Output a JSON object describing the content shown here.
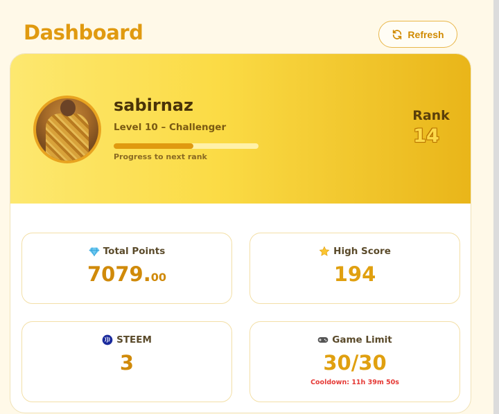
{
  "header": {
    "title": "Dashboard",
    "refresh_label": "Refresh"
  },
  "profile": {
    "username": "sabirnaz",
    "level": "Level 10 – Challenger",
    "progress": 0.55,
    "progress_label": "Progress to next rank",
    "rank_label": "Rank",
    "rank_value": "14"
  },
  "stats": {
    "total_points": {
      "title": "Total Points",
      "value": "7079.",
      "decimals": "00"
    },
    "high_score": {
      "title": "High Score",
      "value": "194"
    },
    "steem": {
      "title": "STEEM",
      "value": "3"
    },
    "game_limit": {
      "title": "Game Limit",
      "value": "30/30",
      "cooldown": "Cooldown: 11h 39m 50s"
    }
  },
  "colors": {
    "accent": "#e09a10",
    "hero_start": "#fde870",
    "hero_end": "#e9b519",
    "cooldown": "#e53935"
  }
}
